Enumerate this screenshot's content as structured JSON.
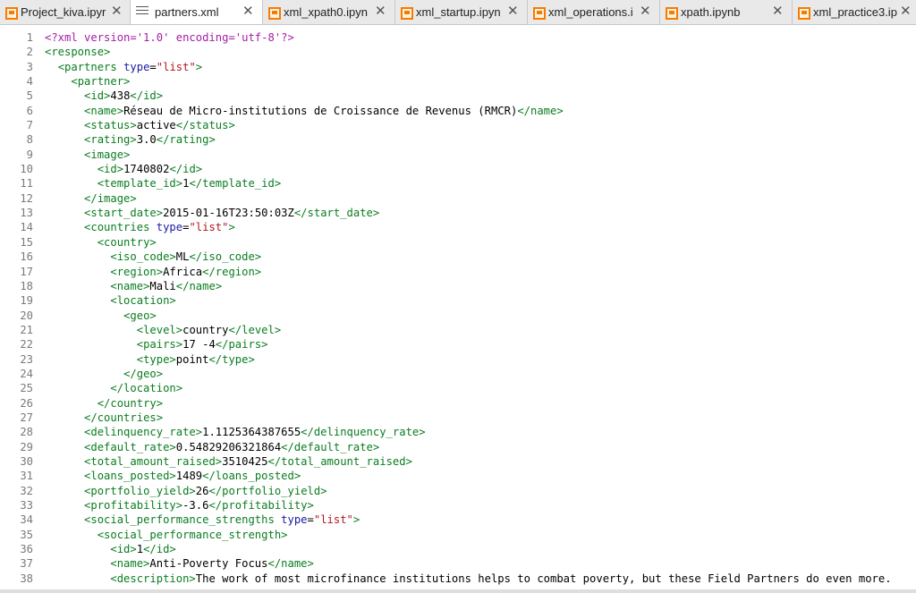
{
  "tabs": [
    {
      "label": "Project_kiva.ipyr",
      "icon": "notebook-icon",
      "active": false
    },
    {
      "label": "partners.xml",
      "icon": "file-icon",
      "active": true
    },
    {
      "label": "xml_xpath0.ipyn",
      "icon": "notebook-icon",
      "active": false
    },
    {
      "label": "xml_startup.ipyn",
      "icon": "notebook-icon",
      "active": false
    },
    {
      "label": "xml_operations.i",
      "icon": "notebook-icon",
      "active": false
    },
    {
      "label": "xpath.ipynb",
      "icon": "notebook-icon",
      "active": false
    },
    {
      "label": "xml_practice3.ip",
      "icon": "notebook-icon",
      "active": false
    }
  ],
  "close_glyph": "✕",
  "colors": {
    "processing": "#a51ea5",
    "tag": "#0a7d20",
    "attribute": "#1a1aa6",
    "string": "#b3171f",
    "notebook_icon": "#f57c00"
  },
  "editor": {
    "lines": [
      {
        "n": "1",
        "indent": 0,
        "tokens": [
          {
            "c": "p",
            "v": "<?xml version='1.0' encoding='utf-8'?>"
          }
        ]
      },
      {
        "n": "2",
        "indent": 0,
        "tokens": [
          {
            "c": "t",
            "v": "<response>"
          }
        ]
      },
      {
        "n": "3",
        "indent": 1,
        "tokens": [
          {
            "c": "t",
            "v": "<partners "
          },
          {
            "c": "a",
            "v": "type"
          },
          {
            "c": "x",
            "v": "="
          },
          {
            "c": "s",
            "v": "\"list\""
          },
          {
            "c": "t",
            "v": ">"
          }
        ]
      },
      {
        "n": "4",
        "indent": 2,
        "tokens": [
          {
            "c": "t",
            "v": "<partner>"
          }
        ]
      },
      {
        "n": "5",
        "indent": 3,
        "tokens": [
          {
            "c": "t",
            "v": "<id>"
          },
          {
            "c": "x",
            "v": "438"
          },
          {
            "c": "t",
            "v": "</id>"
          }
        ]
      },
      {
        "n": "6",
        "indent": 3,
        "tokens": [
          {
            "c": "t",
            "v": "<name>"
          },
          {
            "c": "x",
            "v": "Réseau de Micro-institutions de Croissance de Revenus (RMCR)"
          },
          {
            "c": "t",
            "v": "</name>"
          }
        ]
      },
      {
        "n": "7",
        "indent": 3,
        "tokens": [
          {
            "c": "t",
            "v": "<status>"
          },
          {
            "c": "x",
            "v": "active"
          },
          {
            "c": "t",
            "v": "</status>"
          }
        ]
      },
      {
        "n": "8",
        "indent": 3,
        "tokens": [
          {
            "c": "t",
            "v": "<rating>"
          },
          {
            "c": "x",
            "v": "3.0"
          },
          {
            "c": "t",
            "v": "</rating>"
          }
        ]
      },
      {
        "n": "9",
        "indent": 3,
        "tokens": [
          {
            "c": "t",
            "v": "<image>"
          }
        ]
      },
      {
        "n": "10",
        "indent": 4,
        "tokens": [
          {
            "c": "t",
            "v": "<id>"
          },
          {
            "c": "x",
            "v": "1740802"
          },
          {
            "c": "t",
            "v": "</id>"
          }
        ]
      },
      {
        "n": "11",
        "indent": 4,
        "tokens": [
          {
            "c": "t",
            "v": "<template_id>"
          },
          {
            "c": "x",
            "v": "1"
          },
          {
            "c": "t",
            "v": "</template_id>"
          }
        ]
      },
      {
        "n": "12",
        "indent": 3,
        "tokens": [
          {
            "c": "t",
            "v": "</image>"
          }
        ]
      },
      {
        "n": "13",
        "indent": 3,
        "tokens": [
          {
            "c": "t",
            "v": "<start_date>"
          },
          {
            "c": "x",
            "v": "2015-01-16T23:50:03Z"
          },
          {
            "c": "t",
            "v": "</start_date>"
          }
        ]
      },
      {
        "n": "14",
        "indent": 3,
        "tokens": [
          {
            "c": "t",
            "v": "<countries "
          },
          {
            "c": "a",
            "v": "type"
          },
          {
            "c": "x",
            "v": "="
          },
          {
            "c": "s",
            "v": "\"list\""
          },
          {
            "c": "t",
            "v": ">"
          }
        ]
      },
      {
        "n": "15",
        "indent": 4,
        "tokens": [
          {
            "c": "t",
            "v": "<country>"
          }
        ]
      },
      {
        "n": "16",
        "indent": 5,
        "tokens": [
          {
            "c": "t",
            "v": "<iso_code>"
          },
          {
            "c": "x",
            "v": "ML"
          },
          {
            "c": "t",
            "v": "</iso_code>"
          }
        ]
      },
      {
        "n": "17",
        "indent": 5,
        "tokens": [
          {
            "c": "t",
            "v": "<region>"
          },
          {
            "c": "x",
            "v": "Africa"
          },
          {
            "c": "t",
            "v": "</region>"
          }
        ]
      },
      {
        "n": "18",
        "indent": 5,
        "tokens": [
          {
            "c": "t",
            "v": "<name>"
          },
          {
            "c": "x",
            "v": "Mali"
          },
          {
            "c": "t",
            "v": "</name>"
          }
        ]
      },
      {
        "n": "19",
        "indent": 5,
        "tokens": [
          {
            "c": "t",
            "v": "<location>"
          }
        ]
      },
      {
        "n": "20",
        "indent": 6,
        "tokens": [
          {
            "c": "t",
            "v": "<geo>"
          }
        ]
      },
      {
        "n": "21",
        "indent": 7,
        "tokens": [
          {
            "c": "t",
            "v": "<level>"
          },
          {
            "c": "x",
            "v": "country"
          },
          {
            "c": "t",
            "v": "</level>"
          }
        ]
      },
      {
        "n": "22",
        "indent": 7,
        "tokens": [
          {
            "c": "t",
            "v": "<pairs>"
          },
          {
            "c": "x",
            "v": "17 -4"
          },
          {
            "c": "t",
            "v": "</pairs>"
          }
        ]
      },
      {
        "n": "23",
        "indent": 7,
        "tokens": [
          {
            "c": "t",
            "v": "<type>"
          },
          {
            "c": "x",
            "v": "point"
          },
          {
            "c": "t",
            "v": "</type>"
          }
        ]
      },
      {
        "n": "24",
        "indent": 6,
        "tokens": [
          {
            "c": "t",
            "v": "</geo>"
          }
        ]
      },
      {
        "n": "25",
        "indent": 5,
        "tokens": [
          {
            "c": "t",
            "v": "</location>"
          }
        ]
      },
      {
        "n": "26",
        "indent": 4,
        "tokens": [
          {
            "c": "t",
            "v": "</country>"
          }
        ]
      },
      {
        "n": "27",
        "indent": 3,
        "tokens": [
          {
            "c": "t",
            "v": "</countries>"
          }
        ]
      },
      {
        "n": "28",
        "indent": 3,
        "tokens": [
          {
            "c": "t",
            "v": "<delinquency_rate>"
          },
          {
            "c": "x",
            "v": "1.1125364387655"
          },
          {
            "c": "t",
            "v": "</delinquency_rate>"
          }
        ]
      },
      {
        "n": "29",
        "indent": 3,
        "tokens": [
          {
            "c": "t",
            "v": "<default_rate>"
          },
          {
            "c": "x",
            "v": "0.54829206321864"
          },
          {
            "c": "t",
            "v": "</default_rate>"
          }
        ]
      },
      {
        "n": "30",
        "indent": 3,
        "tokens": [
          {
            "c": "t",
            "v": "<total_amount_raised>"
          },
          {
            "c": "x",
            "v": "3510425"
          },
          {
            "c": "t",
            "v": "</total_amount_raised>"
          }
        ]
      },
      {
        "n": "31",
        "indent": 3,
        "tokens": [
          {
            "c": "t",
            "v": "<loans_posted>"
          },
          {
            "c": "x",
            "v": "1489"
          },
          {
            "c": "t",
            "v": "</loans_posted>"
          }
        ]
      },
      {
        "n": "32",
        "indent": 3,
        "tokens": [
          {
            "c": "t",
            "v": "<portfolio_yield>"
          },
          {
            "c": "x",
            "v": "26"
          },
          {
            "c": "t",
            "v": "</portfolio_yield>"
          }
        ]
      },
      {
        "n": "33",
        "indent": 3,
        "tokens": [
          {
            "c": "t",
            "v": "<profitability>"
          },
          {
            "c": "x",
            "v": "-3.6"
          },
          {
            "c": "t",
            "v": "</profitability>"
          }
        ]
      },
      {
        "n": "34",
        "indent": 3,
        "tokens": [
          {
            "c": "t",
            "v": "<social_performance_strengths "
          },
          {
            "c": "a",
            "v": "type"
          },
          {
            "c": "x",
            "v": "="
          },
          {
            "c": "s",
            "v": "\"list\""
          },
          {
            "c": "t",
            "v": ">"
          }
        ]
      },
      {
        "n": "35",
        "indent": 4,
        "tokens": [
          {
            "c": "t",
            "v": "<social_performance_strength>"
          }
        ]
      },
      {
        "n": "36",
        "indent": 5,
        "tokens": [
          {
            "c": "t",
            "v": "<id>"
          },
          {
            "c": "x",
            "v": "1"
          },
          {
            "c": "t",
            "v": "</id>"
          }
        ]
      },
      {
        "n": "37",
        "indent": 5,
        "tokens": [
          {
            "c": "t",
            "v": "<name>"
          },
          {
            "c": "x",
            "v": "Anti-Poverty Focus"
          },
          {
            "c": "t",
            "v": "</name>"
          }
        ]
      },
      {
        "n": "38",
        "indent": 5,
        "tokens": [
          {
            "c": "t",
            "v": "<description>"
          },
          {
            "c": "x",
            "v": "The work of most microfinance institutions helps to combat poverty, but these Field Partners do even more."
          }
        ]
      }
    ]
  }
}
